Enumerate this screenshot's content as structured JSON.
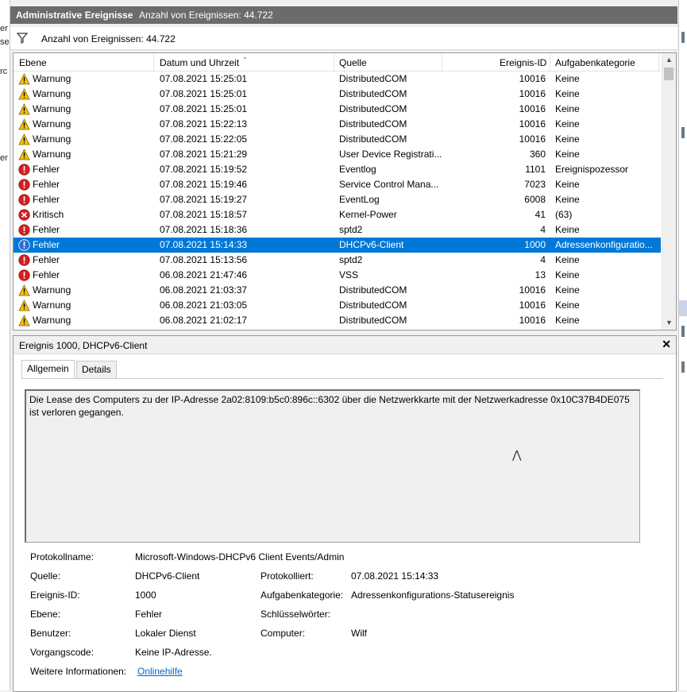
{
  "left_fragments": [
    "er",
    "se",
    "rc",
    "er"
  ],
  "header": {
    "title": "Administrative Ereignisse",
    "count": "Anzahl von Ereignissen: 44.722"
  },
  "filter": {
    "text": "Anzahl von Ereignissen: 44.722"
  },
  "grid": {
    "columns": [
      "Ebene",
      "Datum und Uhrzeit",
      "Quelle",
      "Ereignis-ID",
      "Aufgabenkategorie"
    ],
    "rows": [
      {
        "level": "Warnung",
        "type": "warning",
        "date": "07.08.2021 15:25:01",
        "source": "DistributedCOM",
        "id": "10016",
        "category": "Keine"
      },
      {
        "level": "Warnung",
        "type": "warning",
        "date": "07.08.2021 15:25:01",
        "source": "DistributedCOM",
        "id": "10016",
        "category": "Keine"
      },
      {
        "level": "Warnung",
        "type": "warning",
        "date": "07.08.2021 15:25:01",
        "source": "DistributedCOM",
        "id": "10016",
        "category": "Keine"
      },
      {
        "level": "Warnung",
        "type": "warning",
        "date": "07.08.2021 15:22:13",
        "source": "DistributedCOM",
        "id": "10016",
        "category": "Keine"
      },
      {
        "level": "Warnung",
        "type": "warning",
        "date": "07.08.2021 15:22:05",
        "source": "DistributedCOM",
        "id": "10016",
        "category": "Keine"
      },
      {
        "level": "Warnung",
        "type": "warning",
        "date": "07.08.2021 15:21:29",
        "source": "User Device Registrati...",
        "id": "360",
        "category": "Keine"
      },
      {
        "level": "Fehler",
        "type": "error",
        "date": "07.08.2021 15:19:52",
        "source": "Eventlog",
        "id": "1101",
        "category": "Ereignispozessor"
      },
      {
        "level": "Fehler",
        "type": "error",
        "date": "07.08.2021 15:19:46",
        "source": "Service Control Mana...",
        "id": "7023",
        "category": "Keine"
      },
      {
        "level": "Fehler",
        "type": "error",
        "date": "07.08.2021 15:19:27",
        "source": "EventLog",
        "id": "6008",
        "category": "Keine"
      },
      {
        "level": "Kritisch",
        "type": "critical",
        "date": "07.08.2021 15:18:57",
        "source": "Kernel-Power",
        "id": "41",
        "category": "(63)"
      },
      {
        "level": "Fehler",
        "type": "error",
        "date": "07.08.2021 15:18:36",
        "source": "sptd2",
        "id": "4",
        "category": "Keine"
      },
      {
        "level": "Fehler",
        "type": "error",
        "date": "07.08.2021 15:14:33",
        "source": "DHCPv6-Client",
        "id": "1000",
        "category": "Adressenkonfiguratio...",
        "selected": true
      },
      {
        "level": "Fehler",
        "type": "error",
        "date": "07.08.2021 15:13:56",
        "source": "sptd2",
        "id": "4",
        "category": "Keine"
      },
      {
        "level": "Fehler",
        "type": "error",
        "date": "06.08.2021 21:47:46",
        "source": "VSS",
        "id": "13",
        "category": "Keine"
      },
      {
        "level": "Warnung",
        "type": "warning",
        "date": "06.08.2021 21:03:37",
        "source": "DistributedCOM",
        "id": "10016",
        "category": "Keine"
      },
      {
        "level": "Warnung",
        "type": "warning",
        "date": "06.08.2021 21:03:05",
        "source": "DistributedCOM",
        "id": "10016",
        "category": "Keine"
      },
      {
        "level": "Warnung",
        "type": "warning",
        "date": "06.08.2021 21:02:17",
        "source": "DistributedCOM",
        "id": "10016",
        "category": "Keine"
      }
    ]
  },
  "detail": {
    "title": "Ereignis 1000, DHCPv6-Client",
    "tabs": [
      "Allgemein",
      "Details"
    ],
    "message": "Die Lease des Computers zu der IP-Adresse 2a02:8109:b5c0:896c::6302 über die Netzwerkkarte mit der Netzwerkadresse 0x10C37B4DE075 ist verloren gegangen.",
    "props": {
      "log_name_label": "Protokollname:",
      "log_name": "Microsoft-Windows-DHCPv6 Client Events/Admin",
      "source_label": "Quelle:",
      "source": "DHCPv6-Client",
      "logged_label": "Protokolliert:",
      "logged": "07.08.2021 15:14:33",
      "event_id_label": "Ereignis-ID:",
      "event_id": "1000",
      "task_label": "Aufgabenkategorie:",
      "task": "Adressenkonfigurations-Statusereignis",
      "level_label": "Ebene:",
      "level": "Fehler",
      "keywords_label": "Schlüsselwörter:",
      "keywords": "",
      "user_label": "Benutzer:",
      "user": "Lokaler Dienst",
      "computer_label": "Computer:",
      "computer": "Wilf",
      "opcode_label": "Vorgangscode:",
      "opcode": "Keine IP-Adresse.",
      "more_label": "Weitere Informationen:",
      "more_link": "Onlinehilfe"
    }
  },
  "colors": {
    "selection": "#0078d7",
    "titlebar": "#6b6b6b",
    "warning": "#f5c400",
    "error": "#d42020"
  }
}
